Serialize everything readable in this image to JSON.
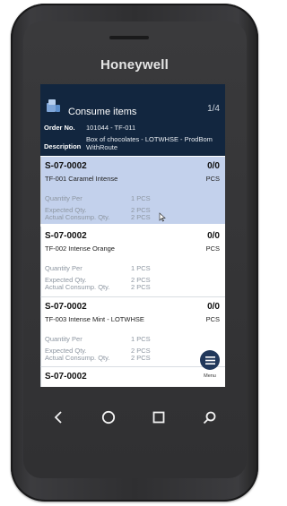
{
  "device": {
    "brand": "Honeywell"
  },
  "header": {
    "title": "Consume items",
    "page": "1/4",
    "order_label": "Order No.",
    "order_value": "101044 - TF-011",
    "description_label": "Description",
    "description_line1": "Box of chocolates - LOTWHSE - ProdBom",
    "description_line2": "WithRoute"
  },
  "cards": [
    {
      "location": "S-07-0002",
      "qty": "0/0",
      "code": "TF-001  Caramel Intense",
      "unit": "PCS",
      "selected": true,
      "rows": [
        {
          "label": "Quantity Per",
          "value": "1 PCS"
        },
        {
          "label": "Expected Qty.",
          "value": "2 PCS"
        },
        {
          "label": "Actual Consump. Qty.",
          "value": "2 PCS"
        }
      ]
    },
    {
      "location": "S-07-0002",
      "qty": "0/0",
      "code": "TF-002  Intense Orange",
      "unit": "PCS",
      "selected": false,
      "rows": [
        {
          "label": "Quantity Per",
          "value": "1 PCS"
        },
        {
          "label": "Expected Qty.",
          "value": "2 PCS"
        },
        {
          "label": "Actual Consump. Qty.",
          "value": "2 PCS"
        }
      ]
    },
    {
      "location": "S-07-0002",
      "qty": "0/0",
      "code": "TF-003  Intense Mint - LOTWHSE",
      "unit": "PCS",
      "selected": false,
      "rows": [
        {
          "label": "Quantity Per",
          "value": "1 PCS"
        },
        {
          "label": "Expected Qty.",
          "value": "2 PCS"
        },
        {
          "label": "Actual Consump. Qty.",
          "value": "2 PCS"
        }
      ]
    },
    {
      "location": "S-07-0002"
    }
  ],
  "menu": {
    "label": "Menu",
    "icon": "hamburger-icon"
  },
  "navbar": {
    "icons": [
      "back-icon",
      "home-icon",
      "recent-apps-icon",
      "search-icon"
    ]
  },
  "colors": {
    "header_bg": "#12263f",
    "selected_card": "#c3d1ec",
    "menu_button": "#20375a"
  }
}
